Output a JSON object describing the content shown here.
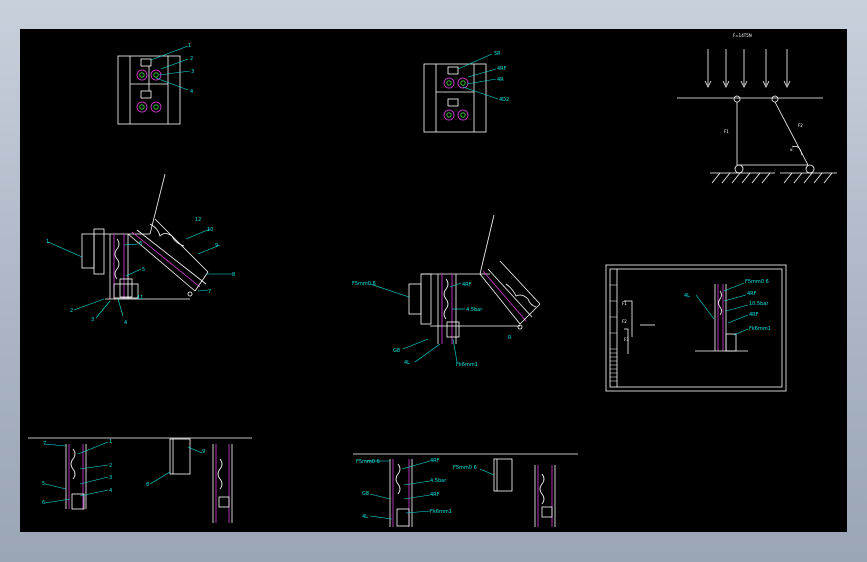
{
  "colors": {
    "background": "#000000",
    "line": "#ffffff",
    "leader": "#00e5e5",
    "accent_magenta": "#e040e0",
    "accent_green": "#40e040"
  },
  "views": {
    "top_left_plan": {
      "labels": [
        "1",
        "2",
        "3",
        "4"
      ]
    },
    "top_mid_plan": {
      "labels": [
        "5R",
        "4RF",
        "4R",
        "4D2"
      ]
    },
    "force_diagram": {
      "title": "F=14T5N",
      "labels": [
        "F1",
        "F2",
        "α"
      ]
    },
    "mid_left": {
      "labels": [
        "1",
        "2",
        "3",
        "4",
        "5",
        "6",
        "7",
        "8",
        "9",
        "10",
        "11",
        "12"
      ]
    },
    "mid_center": {
      "labels": [
        "F5mm0 6",
        "4RF",
        "4.5bar",
        "G8",
        "4L",
        "Fk6mm1",
        "R"
      ]
    },
    "title_block": {
      "labels": [
        "4L",
        "F5mm0 6",
        "4RF",
        "10.5bar",
        "4RF",
        "Fk6mm1",
        "F1",
        "F2",
        "F3"
      ]
    },
    "bottom_left": {
      "labels": [
        "7",
        "1",
        "2",
        "3",
        "4",
        "5",
        "6",
        "8",
        "9"
      ]
    },
    "bottom_center": {
      "labels": [
        "F5mm0 6",
        "4RF",
        "4.5bar",
        "4RF",
        "Fk6mm1",
        "4L",
        "G8",
        "F5mm0 6"
      ]
    }
  }
}
